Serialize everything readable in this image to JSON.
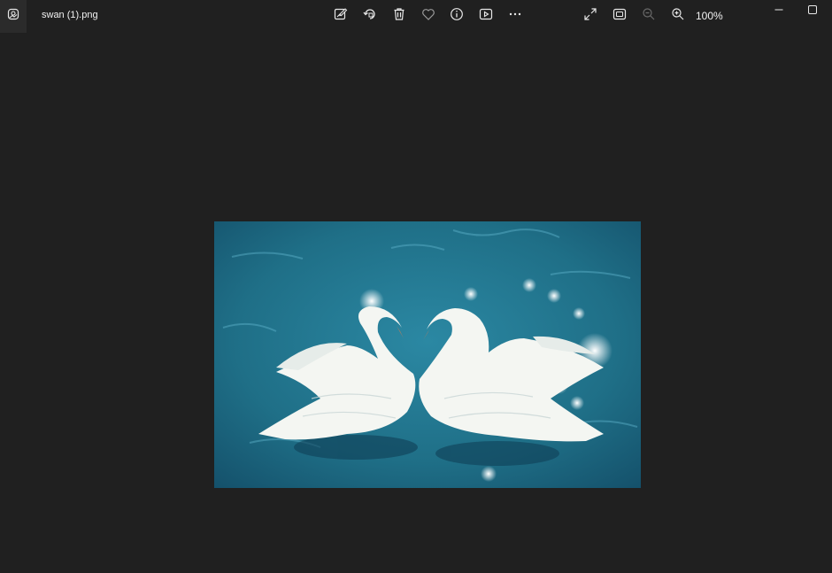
{
  "window": {
    "file_name": "swan (1).png",
    "zoom_level": "100%"
  },
  "toolbar": {
    "left_icons": [
      "edit-image-icon",
      "rotate-icon",
      "delete-icon",
      "favorite-icon",
      "info-icon",
      "slideshow-icon",
      "more-icon"
    ],
    "right_icons": [
      "fullscreen-icon",
      "fit-to-window-icon",
      "zoom-out-icon",
      "zoom-in-icon"
    ],
    "zoom_out_enabled": false
  },
  "window_controls": [
    "minimize-icon",
    "maximize-icon"
  ],
  "image": {
    "subject": "two-white-swans-on-blue-water",
    "colors": {
      "water": "#1f6f87",
      "water_dark": "#14506a",
      "swan": "#f4f6f2"
    }
  },
  "colors": {
    "background": "#202020",
    "icon": "#e8e8e8",
    "icon_disabled": "#6a6a6a"
  }
}
